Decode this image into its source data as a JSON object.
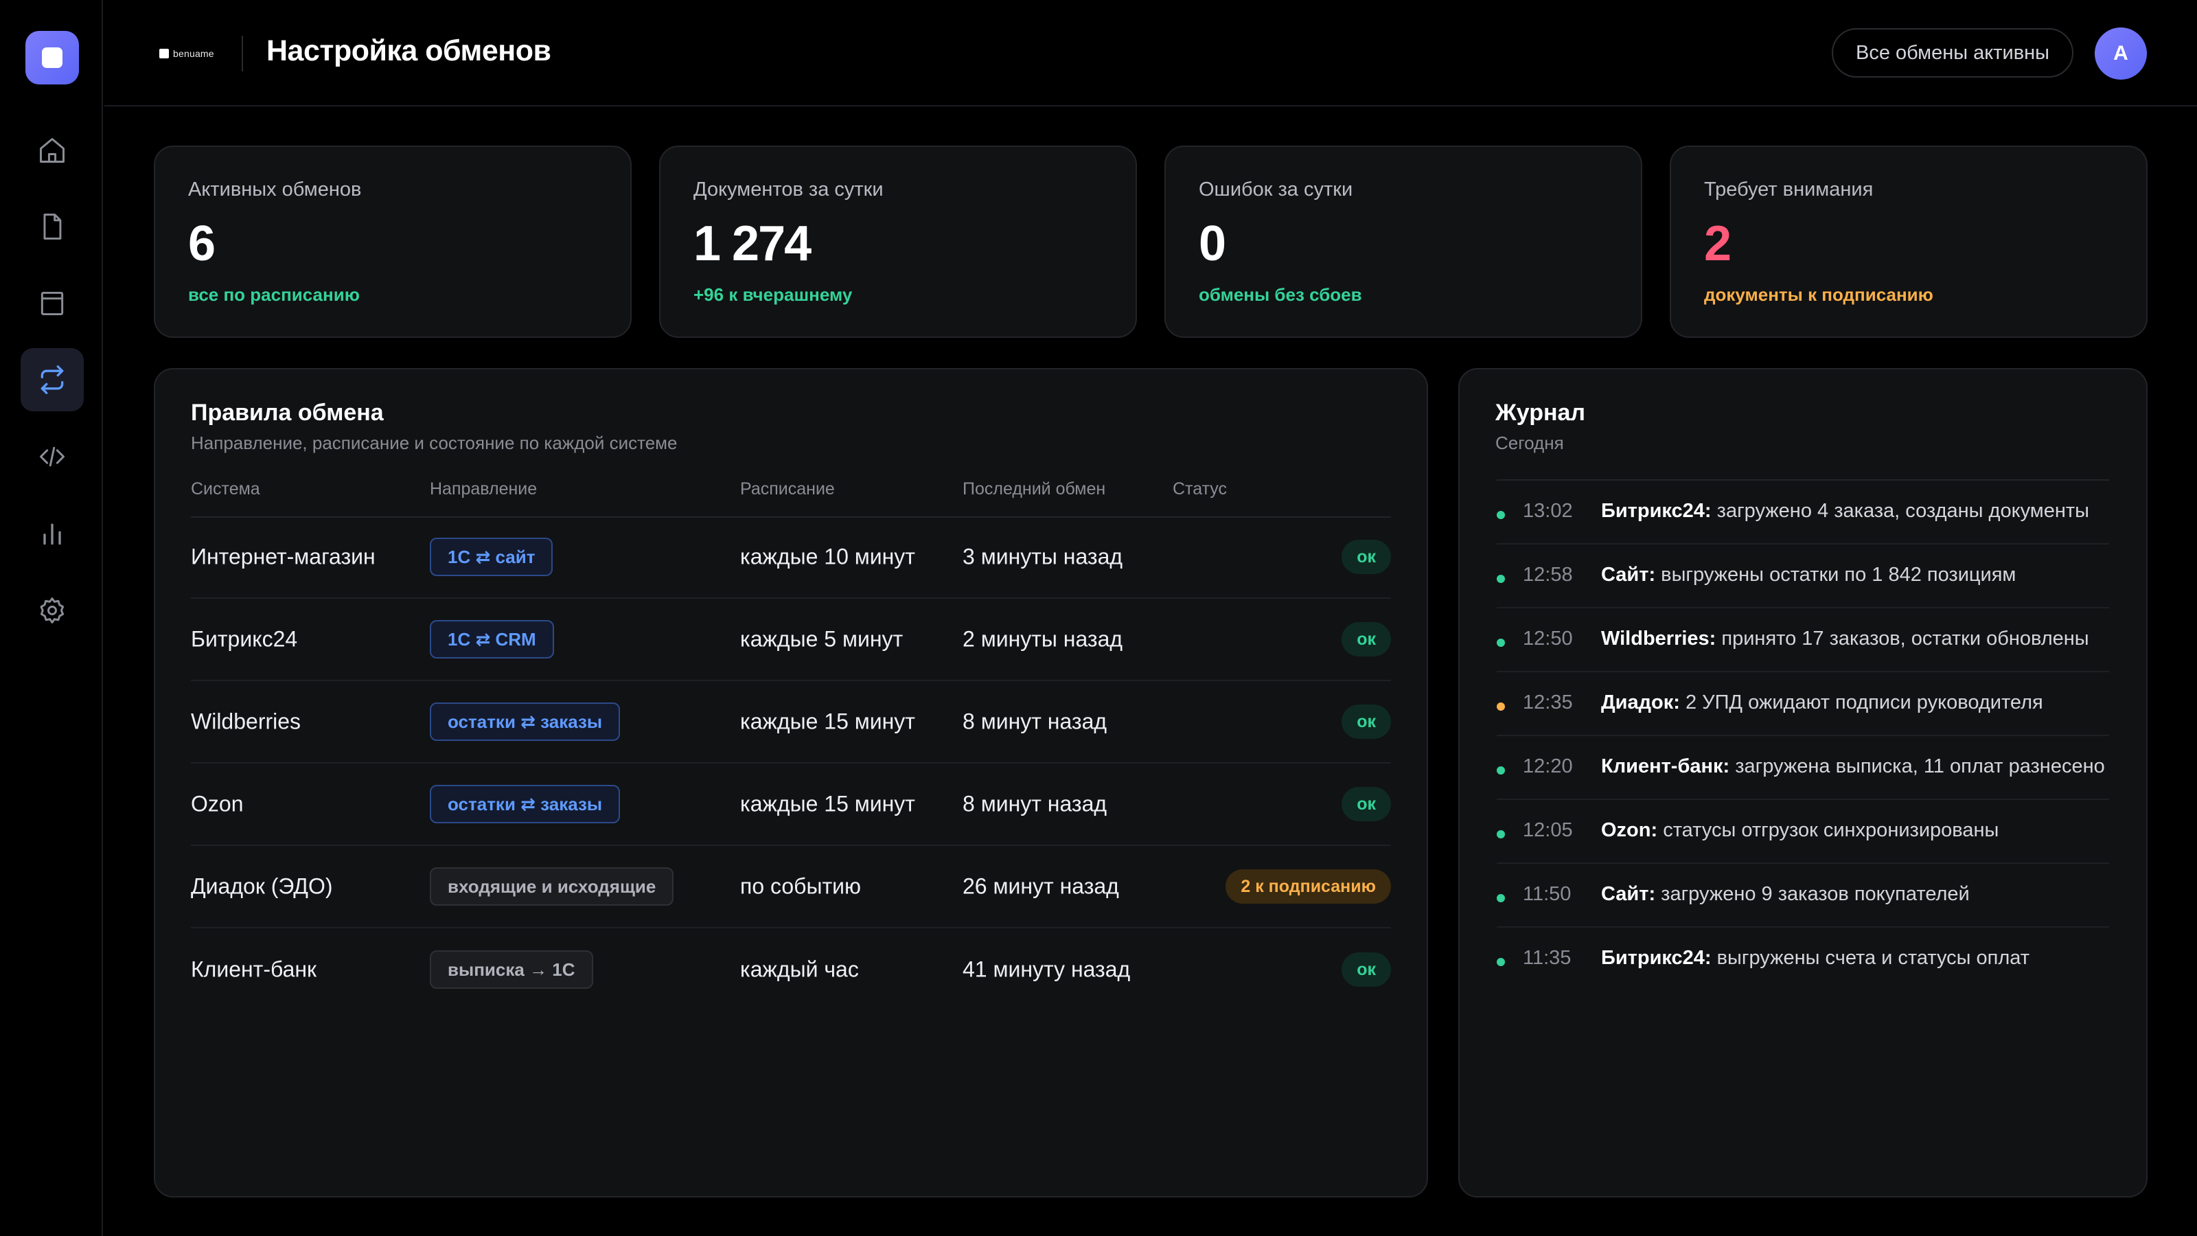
{
  "colors": {
    "accent": "#6b70f8",
    "ok": "#34d399",
    "warn": "#fbb04a",
    "attention": "#ff5a7a",
    "link": "#5f9bff"
  },
  "sidebar": {
    "items": [
      {
        "icon": "home-icon"
      },
      {
        "icon": "document-icon"
      },
      {
        "icon": "window-icon"
      },
      {
        "icon": "sync-icon",
        "active": true
      },
      {
        "icon": "code-icon"
      },
      {
        "icon": "chart-icon"
      },
      {
        "icon": "gear-icon"
      }
    ]
  },
  "header": {
    "brand": "benuame",
    "title": "Настройка обменов",
    "status": "Все обмены активны",
    "avatar": "A"
  },
  "stats": [
    {
      "label": "Активных обменов",
      "value": "6",
      "note": "все по расписанию"
    },
    {
      "label": "Документов за сутки",
      "value": "1 274",
      "note": "+96 к вчерашнему"
    },
    {
      "label": "Ошибок за сутки",
      "value": "0",
      "note": "обмены без сбоев"
    },
    {
      "label": "Требует внимания",
      "value": "2",
      "note": "документы к подписанию"
    }
  ],
  "rules": {
    "title": "Правила обмена",
    "subtitle": "Направление, расписание и состояние по каждой системе",
    "columns": [
      "Система",
      "Направление",
      "Расписание",
      "Последний обмен",
      "Статус"
    ],
    "rows": [
      {
        "system": "Интернет-магазин",
        "direction": "1С ⇄ сайт",
        "schedule": "каждые 10 минут",
        "last": "3 минуты назад",
        "status": "ок"
      },
      {
        "system": "Битрикс24",
        "direction": "1С ⇄ CRM",
        "schedule": "каждые 5 минут",
        "last": "2 минуты назад",
        "status": "ок"
      },
      {
        "system": "Wildberries",
        "direction": "остатки ⇄ заказы",
        "schedule": "каждые 15 минут",
        "last": "8 минут назад",
        "status": "ок"
      },
      {
        "system": "Ozon",
        "direction": "остатки ⇄ заказы",
        "schedule": "каждые 15 минут",
        "last": "8 минут назад",
        "status": "ок"
      },
      {
        "system": "Диадок (ЭДО)",
        "direction": "входящие и исходящие",
        "schedule": "по событию",
        "last": "26 минут назад",
        "status": "2 к подписанию"
      },
      {
        "system": "Клиент-банк",
        "direction": "выписка → 1С",
        "schedule": "каждый час",
        "last": "41 минуту назад",
        "status": "ок"
      }
    ]
  },
  "journal": {
    "title": "Журнал",
    "subtitle": "Сегодня",
    "items": [
      {
        "time": "13:02",
        "source": "Битрикс24:",
        "text": " загружено 4 заказа, созданы документы"
      },
      {
        "time": "12:58",
        "source": "Сайт:",
        "text": " выгружены остатки по 1 842 позициям"
      },
      {
        "time": "12:50",
        "source": "Wildberries:",
        "text": " принято 17 заказов, остатки обновлены"
      },
      {
        "time": "12:35",
        "source": "Диадок:",
        "text": " 2 УПД ожидают подписи руководителя"
      },
      {
        "time": "12:20",
        "source": "Клиент-банк:",
        "text": " загружена выписка, 11 оплат разнесено"
      },
      {
        "time": "12:05",
        "source": "Ozon:",
        "text": " статусы отгрузок синхронизированы"
      },
      {
        "time": "11:50",
        "source": "Сайт:",
        "text": " загружено 9 заказов покупателей"
      },
      {
        "time": "11:35",
        "source": "Битрикс24:",
        "text": " выгружены счета и статусы оплат"
      }
    ]
  }
}
